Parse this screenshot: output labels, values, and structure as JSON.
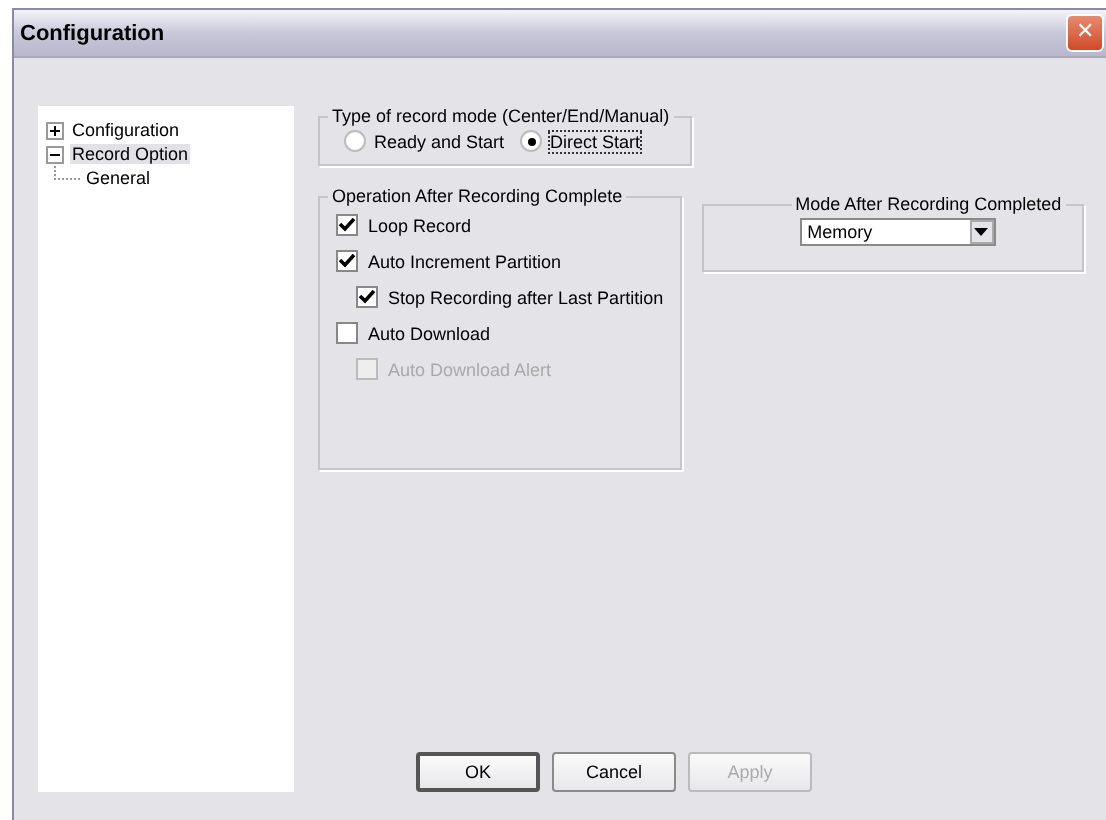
{
  "window": {
    "title": "Configuration",
    "close": "✕"
  },
  "tree": [
    {
      "label": "Configuration",
      "expanded": false,
      "selected": false
    },
    {
      "label": "Record Option",
      "expanded": true,
      "selected": true,
      "children": [
        {
          "label": "General",
          "selected": false
        }
      ]
    }
  ],
  "record_mode": {
    "title": "Type of record mode (Center/End/Manual)",
    "options": [
      {
        "label": "Ready and Start",
        "selected": false
      },
      {
        "label": "Direct Start",
        "selected": true
      }
    ]
  },
  "operation": {
    "title": "Operation After Recording Complete",
    "items": [
      {
        "label": "Loop Record",
        "checked": true,
        "disabled": false
      },
      {
        "label": "Auto Increment Partition",
        "checked": true,
        "disabled": false,
        "children": [
          {
            "label": "Stop Recording after Last Partition",
            "checked": true,
            "disabled": false
          }
        ]
      },
      {
        "label": "Auto Download",
        "checked": false,
        "disabled": false,
        "children": [
          {
            "label": "Auto Download Alert",
            "checked": false,
            "disabled": true
          }
        ]
      }
    ]
  },
  "mode_after": {
    "title": "Mode After Recording Completed",
    "value": "Memory"
  },
  "buttons": [
    {
      "label": "OK",
      "disabled": false,
      "default": true
    },
    {
      "label": "Cancel",
      "disabled": false,
      "default": false
    },
    {
      "label": "Apply",
      "disabled": true,
      "default": false
    }
  ]
}
